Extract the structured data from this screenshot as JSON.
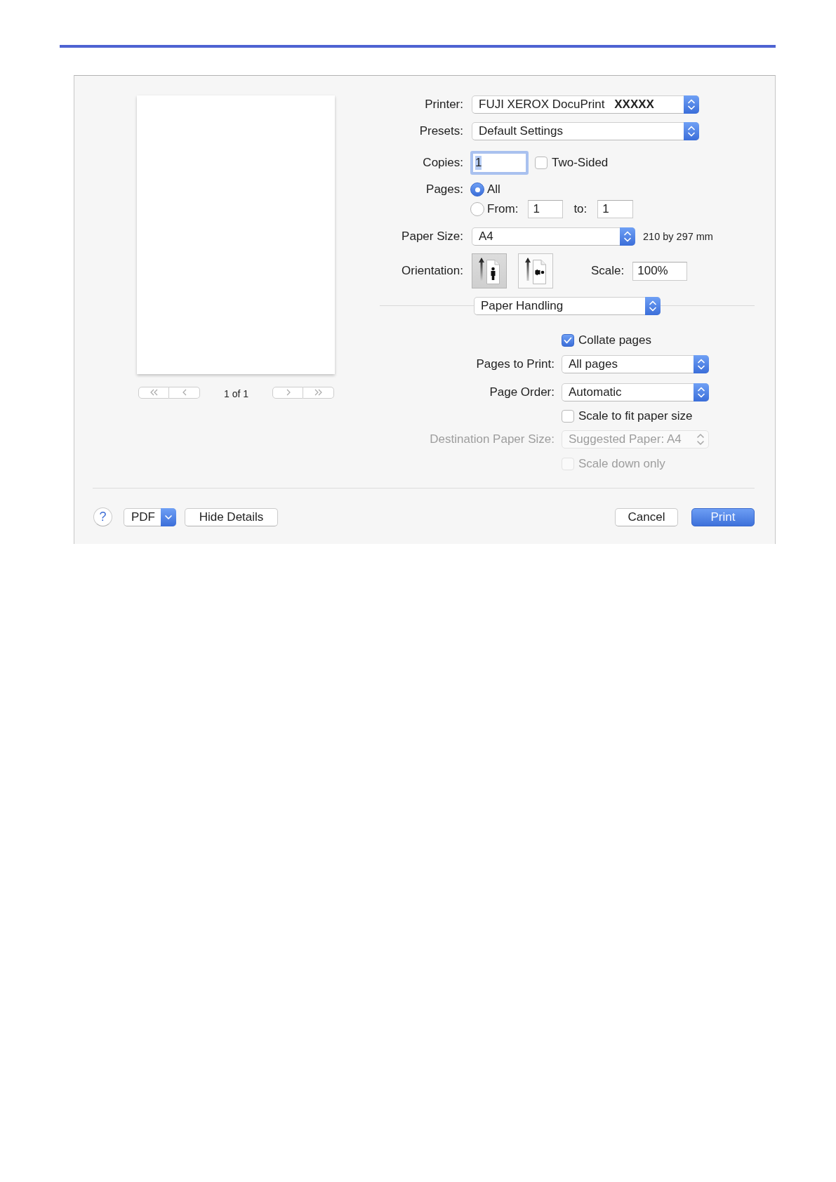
{
  "preview": {
    "page_indicator": "1 of 1"
  },
  "settings": {
    "printer": {
      "label": "Printer:",
      "value": "FUJI XEROX DocuPrint **XXXXX**"
    },
    "presets": {
      "label": "Presets:",
      "value": "Default Settings"
    },
    "copies": {
      "label": "Copies:",
      "value": "1",
      "focused": true
    },
    "two_sided": {
      "label": "Two-Sided",
      "checked": false
    },
    "pages": {
      "label": "Pages:",
      "options": [
        {
          "label": "All",
          "selected": true
        },
        {
          "label": "From:",
          "selected": false
        }
      ],
      "from": "1",
      "to_label": "to:",
      "to": "1"
    },
    "paper_size": {
      "label": "Paper Size:",
      "value": "A4",
      "dimensions": "210 by 297 mm"
    },
    "orientation": {
      "label": "Orientation:",
      "options": [
        {
          "kind": "portrait",
          "selected": true
        },
        {
          "kind": "landscape",
          "selected": false
        }
      ]
    },
    "scale": {
      "label": "Scale:",
      "value": "100%"
    }
  },
  "panel_menu": {
    "value": "Paper Handling"
  },
  "paper_handling": [
    {
      "kind": "checkbox",
      "label": "Collate pages",
      "checked": true,
      "disabled": false
    },
    {
      "kind": "popup",
      "label": "Pages to Print:",
      "value": "All pages",
      "disabled": false
    },
    {
      "kind": "popup",
      "label": "Page Order:",
      "value": "Automatic",
      "disabled": false
    },
    {
      "kind": "checkbox",
      "label": "Scale to fit paper size",
      "checked": false,
      "disabled": false
    },
    {
      "kind": "popup",
      "label": "Destination Paper Size:",
      "value": "Suggested Paper: A4",
      "disabled": true
    },
    {
      "kind": "checkbox",
      "label": "Scale down only",
      "checked": false,
      "disabled": true
    }
  ],
  "footer": {
    "help": "?",
    "pdf": "PDF",
    "details": "Hide Details",
    "buttons": [
      {
        "label": "Cancel",
        "default": false
      },
      {
        "label": "Print",
        "default": true
      }
    ]
  }
}
